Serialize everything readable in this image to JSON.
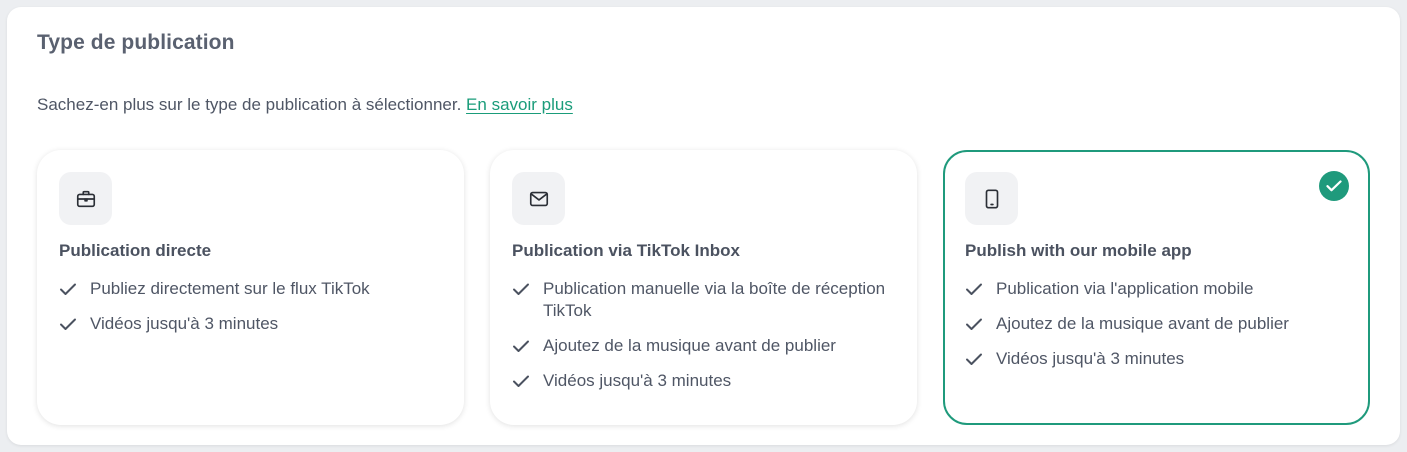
{
  "section": {
    "title": "Type de publication",
    "subtitle_text": "Sachez-en plus sur le type de publication à sélectionner. ",
    "learn_more_link": "En savoir plus"
  },
  "cards": [
    {
      "icon": "briefcase-icon",
      "title": "Publication directe",
      "selected": false,
      "features": [
        "Publiez directement sur le flux TikTok",
        "Vidéos jusqu'à 3 minutes"
      ]
    },
    {
      "icon": "envelope-icon",
      "title": "Publication via TikTok Inbox",
      "selected": false,
      "features": [
        "Publication manuelle via la boîte de réception TikTok",
        "Ajoutez de la musique avant de publier",
        "Vidéos jusqu'à 3 minutes"
      ]
    },
    {
      "icon": "smartphone-icon",
      "title": "Publish with our mobile app",
      "selected": true,
      "features": [
        "Publication via l'application mobile",
        "Ajoutez de la musique avant de publier",
        "Vidéos jusqu'à 3 minutes"
      ]
    }
  ],
  "colors": {
    "accent": "#1f9a7c",
    "link": "#1a9c7a",
    "text": "#4f5665",
    "icon_box": "#f1f2f4"
  }
}
